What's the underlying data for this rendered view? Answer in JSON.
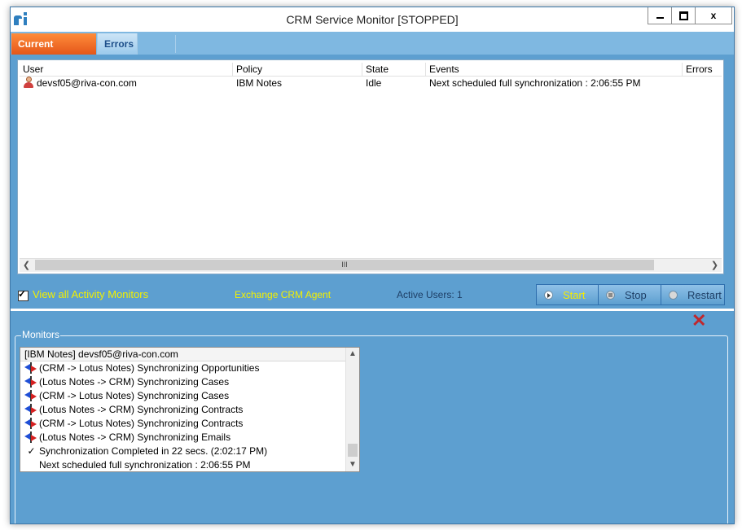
{
  "window": {
    "title": "CRM Service Monitor  [STOPPED]",
    "controls": {
      "minimize_icon": "minimize-icon",
      "maximize_icon": "maximize-icon",
      "close_label": "x"
    }
  },
  "tabs": [
    {
      "label": "Current Activity",
      "active": true
    },
    {
      "label": "Errors",
      "active": false
    }
  ],
  "activity_table": {
    "columns": [
      "User",
      "Policy",
      "State",
      "Events",
      "Errors"
    ],
    "rows": [
      {
        "user": "devsf05@riva-con.com",
        "policy": "IBM Notes",
        "state": "Idle",
        "events": "Next scheduled full synchronization : 2:06:55 PM",
        "errors": "",
        "icon": "user-icon"
      }
    ],
    "scroll_grip": "III"
  },
  "controls_bar": {
    "view_all_label": "View all Activity Monitors",
    "view_all_checked": true,
    "agent_label": "Exchange CRM Agent",
    "active_users": "Active Users: 1",
    "start_label": "Start",
    "stop_label": "Stop",
    "restart_label": "Restart"
  },
  "monitors": {
    "legend": "Monitors",
    "header": "[IBM Notes] devsf05@riva-con.com",
    "items": [
      {
        "icon": "sync-icon",
        "text": "(CRM -> Lotus Notes) Synchronizing Opportunities"
      },
      {
        "icon": "sync-icon",
        "text": "(Lotus Notes -> CRM) Synchronizing Cases"
      },
      {
        "icon": "sync-icon",
        "text": "(CRM -> Lotus Notes) Synchronizing Cases"
      },
      {
        "icon": "sync-icon",
        "text": "(Lotus Notes -> CRM) Synchronizing Contracts"
      },
      {
        "icon": "sync-icon",
        "text": "(CRM -> Lotus Notes) Synchronizing Contracts"
      },
      {
        "icon": "sync-icon",
        "text": "(Lotus Notes -> CRM) Synchronizing Emails"
      },
      {
        "icon": "check-icon",
        "text": "Synchronization Completed in 22 secs.  (2:02:17 PM)"
      },
      {
        "icon": "none",
        "text": "Next scheduled full synchronization : 2:06:55 PM"
      }
    ]
  },
  "colors": {
    "window_bg": "#5d9fd0",
    "active_tab": "#e4571a",
    "highlight_text": "#f3f000",
    "close_x": "#c0272d"
  }
}
